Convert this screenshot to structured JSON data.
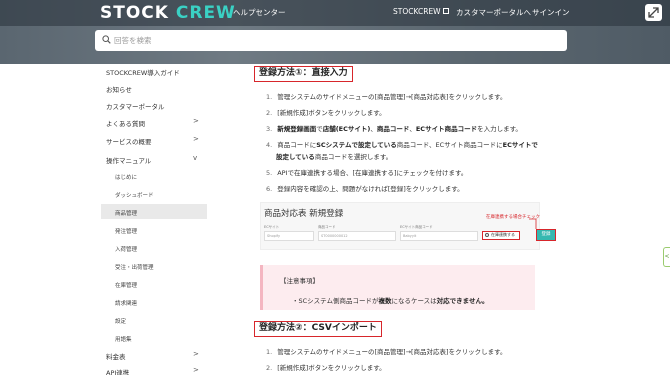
{
  "header": {
    "logo_stock": "STOCK",
    "logo_crew": "CREW",
    "help_center": "ヘルプセンター",
    "nav_stockcrew": "STOCKCREW",
    "nav_portal": "カスタマーポータルへ",
    "nav_signin": "サインイン",
    "search_placeholder": "回答を検索"
  },
  "sidebar": {
    "items": [
      {
        "label": "STOCKCREW導入ガイド"
      },
      {
        "label": "お知らせ"
      },
      {
        "label": "カスタマーポータル"
      },
      {
        "label": "よくある質問",
        "chevron": ">"
      },
      {
        "label": "サービスの概要",
        "chevron": ">"
      },
      {
        "label": "操作マニュアル",
        "chevron": "v"
      },
      {
        "label": "料金表",
        "chevron": ">"
      },
      {
        "label": "API連携",
        "chevron": ">"
      }
    ],
    "subitems": [
      {
        "label": "はじめに"
      },
      {
        "label": "ダッシュボード"
      },
      {
        "label": "商品管理"
      },
      {
        "label": "発注管理"
      },
      {
        "label": "入荷管理"
      },
      {
        "label": "受注・出荷管理"
      },
      {
        "label": "在庫管理"
      },
      {
        "label": "請求関連"
      },
      {
        "label": "設定"
      },
      {
        "label": "用語集"
      }
    ]
  },
  "content": {
    "section1": {
      "title": "登録方法①：直接入力",
      "steps": {
        "s1": {
          "num": "1.",
          "text": "管理システムのサイドメニューの[商品管理]→[商品対応表]をクリックします。"
        },
        "s2": {
          "num": "2.",
          "text": "[新規作成]ボタンをクリックします。"
        },
        "s3": {
          "num": "3.",
          "b1": "新規登録画面",
          "t1": "で",
          "b2": "店舗(ECサイト)",
          "t2": "、",
          "b3": "商品コード",
          "t3": "、",
          "b4": "ECサイト商品コード",
          "t4": "を入力します。"
        },
        "s4": {
          "num": "4.",
          "t1": "商品コードに",
          "b1": "SCシステムで設定している",
          "t2": "商品コード、ECサイト商品コードに",
          "b2": "ECサイトで",
          "b3": "設定している",
          "t3": "商品コードを選択します。"
        },
        "s5": {
          "num": "5.",
          "text": "APIで在庫連携する場合、[在庫連携する]にチェックを付けます。"
        },
        "s6": {
          "num": "6.",
          "text": "登録内容を確認の上、問題がなければ[登録]をクリックします。"
        }
      }
    },
    "screenshot": {
      "title": "商品対応表 新規登録",
      "label_ec": "ECサイト",
      "label_code": "商品コード",
      "label_ec_code": "ECサイト商品コード",
      "value_ec": "Shopify",
      "value_code": "ST0000000012",
      "value_ec_code": "Babyyit",
      "annotation": "在庫連携する場合チェック",
      "checkbox_label": "在庫連携する",
      "register_button": "登録"
    },
    "note": {
      "title": "【注意事項】",
      "bullet": "・",
      "t1": "SCシステム側商品コードが",
      "b1": "複数",
      "t2": "になるケースは",
      "b2": "対応できません。"
    },
    "section2": {
      "title": "登録方法②：CSVインポート",
      "steps": {
        "s1": {
          "num": "1.",
          "text": "管理システムのサイドメニューの[商品管理]→[商品対応表]をクリックします。"
        },
        "s2": {
          "num": "2.",
          "text": "[新規作成]ボタンをクリックします。"
        }
      }
    }
  },
  "side_tab": "<"
}
